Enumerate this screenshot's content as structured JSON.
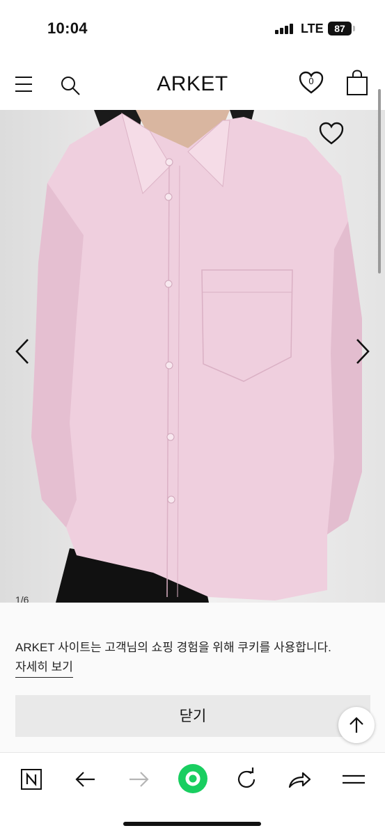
{
  "status_bar": {
    "time": "10:04",
    "network": "LTE",
    "battery": "87"
  },
  "header": {
    "brand": "ARKET",
    "wishlist_count": "0",
    "icons": [
      "menu-icon",
      "search-icon",
      "heart-icon",
      "shopping-bag-icon"
    ]
  },
  "product": {
    "image_description_icon": "pink-shirt-photo",
    "pager": "1/6"
  },
  "cookie_banner": {
    "message": "ARKET 사이트는 고객님의 쇼핑 경험을 위해 쿠키를 사용합니다.",
    "more_link": "자세히 보기",
    "close_label": "닫기"
  },
  "browser_toolbar": {
    "icons": [
      "naver-n-icon",
      "back-arrow-icon",
      "forward-arrow-icon",
      "green-circle-icon",
      "reload-icon",
      "share-icon",
      "menu-lines-icon"
    ]
  },
  "colors": {
    "shirt": "#efcfde",
    "image_bg": "#e9e8e8",
    "green_button": "#19ce60"
  }
}
